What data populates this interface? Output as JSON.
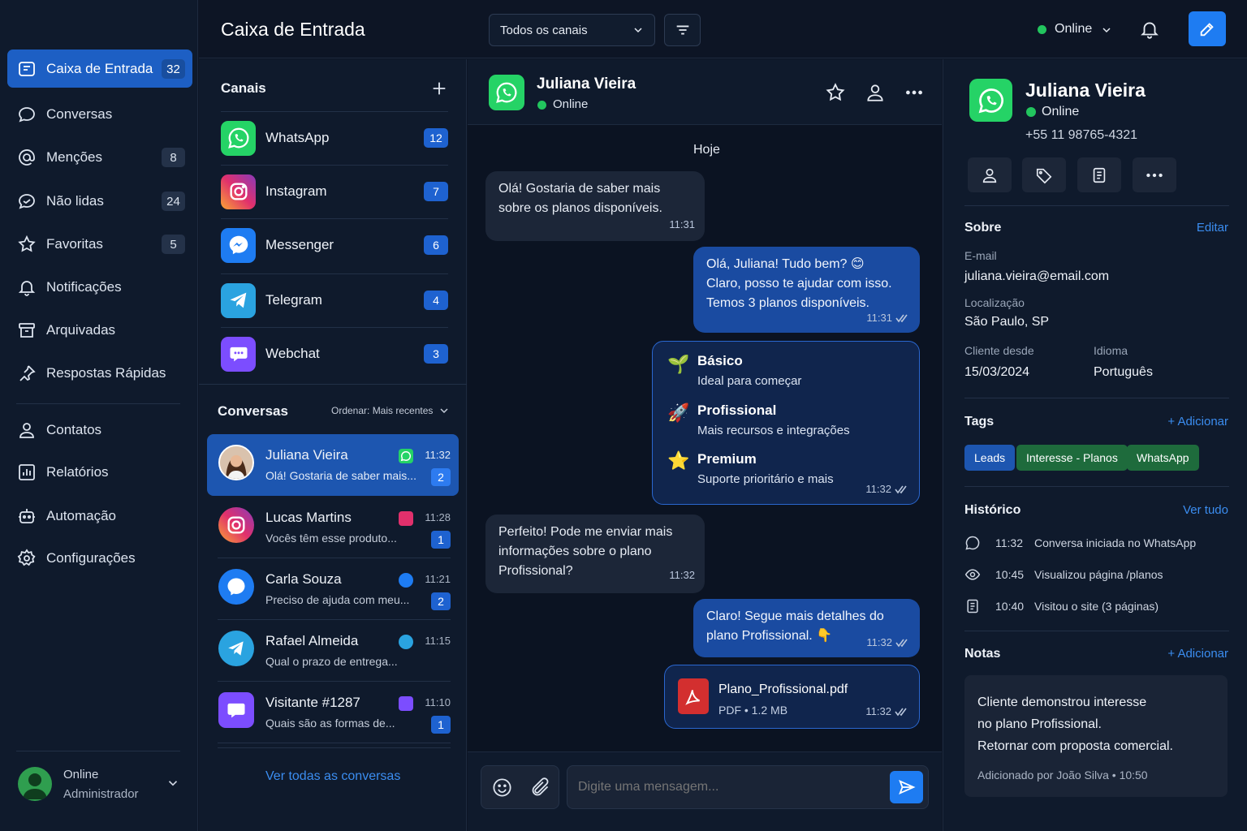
{
  "sidebar": {
    "items": [
      {
        "label": "Caixa de Entrada",
        "count": "32",
        "icon": "inbox-icon"
      },
      {
        "label": "Conversas",
        "count": "",
        "icon": "chat-bubble-icon"
      },
      {
        "label": "Menções",
        "count": "8",
        "icon": "at-icon"
      },
      {
        "label": "Não lidas",
        "count": "24",
        "icon": "unread-icon"
      },
      {
        "label": "Favoritas",
        "count": "5",
        "icon": "star-icon"
      },
      {
        "label": "Notificações",
        "count": "",
        "icon": "bell-icon"
      },
      {
        "label": "Arquivadas",
        "count": "",
        "icon": "archive-icon"
      },
      {
        "label": "Respostas Rápidas",
        "count": "",
        "icon": "pin-icon"
      },
      {
        "label": "Contatos",
        "count": "",
        "icon": "contact-icon"
      },
      {
        "label": "Relatórios",
        "count": "",
        "icon": "report-icon"
      },
      {
        "label": "Automação",
        "count": "",
        "icon": "robot-icon"
      },
      {
        "label": "Configurações",
        "count": "",
        "icon": "gear-icon"
      }
    ],
    "user": {
      "status": "Online",
      "role": "Administrador"
    }
  },
  "topbar": {
    "title": "Caixa de Entrada",
    "channel_filter": "Todos os canais",
    "status": "Online"
  },
  "channels": {
    "title": "Canais",
    "items": [
      {
        "name": "WhatsApp",
        "count": "12",
        "color": "#25d366"
      },
      {
        "name": "Instagram",
        "count": "7",
        "color": "#e1306c"
      },
      {
        "name": "Messenger",
        "count": "6",
        "color": "#1e7cf2"
      },
      {
        "name": "Telegram",
        "count": "4",
        "color": "#2aa3e0"
      },
      {
        "name": "Webchat",
        "count": "3",
        "color": "#7c4dff"
      }
    ]
  },
  "conversations": {
    "title": "Conversas",
    "sort_label": "Ordenar: Mais recentes",
    "view_all": "Ver todas as conversas",
    "items": [
      {
        "name": "Juliana Vieira",
        "preview": "Olá! Gostaria de saber mais...",
        "time": "11:32",
        "unread": "2",
        "channel": "WhatsApp"
      },
      {
        "name": "Lucas Martins",
        "preview": "Vocês têm esse produto...",
        "time": "11:28",
        "unread": "1",
        "channel": "Instagram"
      },
      {
        "name": "Carla Souza",
        "preview": "Preciso de ajuda com meu...",
        "time": "11:21",
        "unread": "2",
        "channel": "Messenger"
      },
      {
        "name": "Rafael Almeida",
        "preview": "Qual o prazo de entrega...",
        "time": "11:15",
        "unread": "",
        "channel": "Telegram"
      },
      {
        "name": "Visitante #1287",
        "preview": "Quais são as formas de...",
        "time": "11:10",
        "unread": "1",
        "channel": "Webchat"
      }
    ]
  },
  "chat": {
    "contact_name": "Juliana Vieira",
    "contact_status": "Online",
    "day_label": "Hoje",
    "messages": [
      {
        "dir": "in",
        "lines": [
          "Olá! Gostaria de saber mais",
          "sobre os planos disponíveis."
        ],
        "time": "11:31"
      },
      {
        "dir": "out",
        "lines": [
          "Olá, Juliana! Tudo bem? 😊",
          "Claro, posso te ajudar com isso.",
          "Temos 3 planos disponíveis."
        ],
        "time": "11:31"
      },
      {
        "dir": "out",
        "type": "plans",
        "time": "11:32",
        "plans": [
          {
            "icon": "🌱",
            "name": "Básico",
            "desc": "Ideal para começar"
          },
          {
            "icon": "🚀",
            "name": "Profissional",
            "desc": "Mais recursos e integrações"
          },
          {
            "icon": "⭐",
            "name": "Premium",
            "desc": "Suporte prioritário e mais"
          }
        ]
      },
      {
        "dir": "in",
        "lines": [
          "Perfeito! Pode me enviar mais",
          "informações sobre o plano",
          "Profissional?"
        ],
        "time": "11:32"
      },
      {
        "dir": "out",
        "lines": [
          "Claro! Segue mais detalhes do",
          "plano Profissional. 👇"
        ],
        "time": "11:32"
      },
      {
        "dir": "out",
        "type": "file",
        "file_name": "Plano_Profissional.pdf",
        "file_meta": "PDF • 1.2 MB",
        "time": "11:32"
      }
    ],
    "input_placeholder": "Digite uma mensagem..."
  },
  "details": {
    "name": "Juliana Vieira",
    "status": "Online",
    "phone": "+55 11 98765-4321",
    "about_title": "Sobre",
    "edit": "Editar",
    "email_label": "E-mail",
    "email": "juliana.vieira@email.com",
    "location_label": "Localização",
    "location": "São Paulo, SP",
    "since_label": "Cliente desde",
    "since": "15/03/2024",
    "lang_label": "Idioma",
    "lang": "Português",
    "tags_title": "Tags",
    "add": "+ Adicionar",
    "tags": [
      "Leads",
      "Interesse - Planos",
      "WhatsApp"
    ],
    "history_title": "Histórico",
    "see_all": "Ver tudo",
    "history": [
      {
        "time": "11:32",
        "text": "Conversa iniciada no WhatsApp",
        "icon": "whatsapp-icon"
      },
      {
        "time": "10:45",
        "text": "Visualizou página /planos",
        "icon": "eye-icon"
      },
      {
        "time": "10:40",
        "text": "Visitou o site (3 páginas)",
        "icon": "document-icon"
      }
    ],
    "notes_title": "Notas",
    "note_lines": [
      "Cliente demonstrou interesse",
      "no plano Profissional.",
      "Retornar com proposta comercial."
    ],
    "note_meta": "Adicionado por João Silva • 10:50"
  }
}
